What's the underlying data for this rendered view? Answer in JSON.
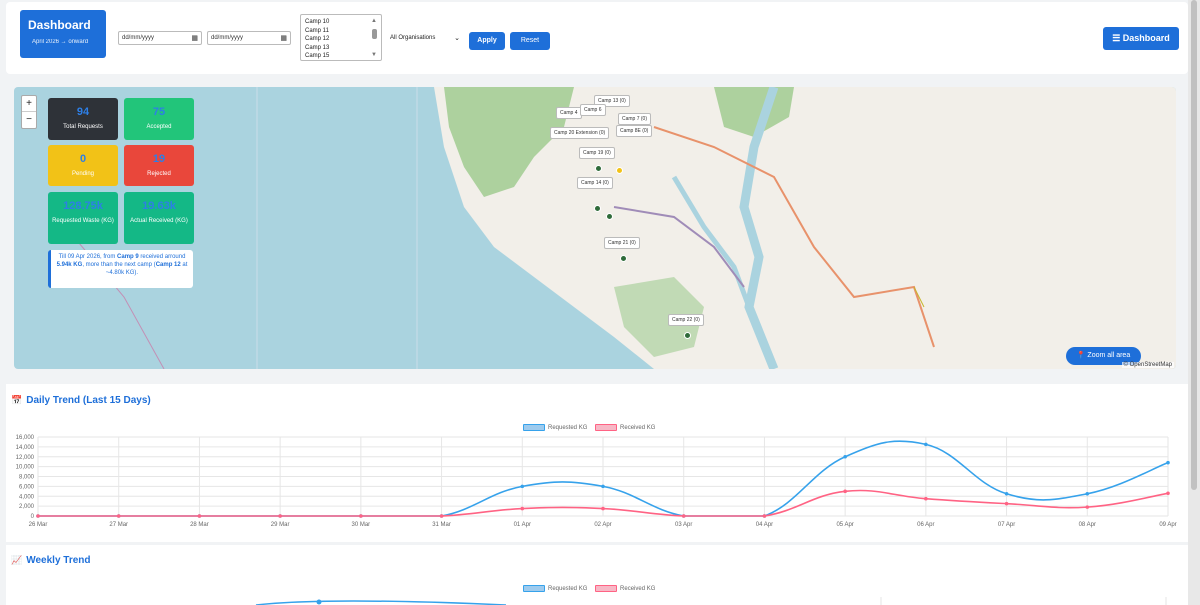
{
  "header": {
    "brand_title": "Dashboard",
    "brand_subtitle": "April 2026 → onward",
    "date_from_placeholder": "dd/mm/yyyy",
    "date_to_placeholder": "dd/mm/yyyy",
    "camp_options": [
      "Camp 10",
      "Camp 11",
      "Camp 12",
      "Camp 13",
      "Camp 15"
    ],
    "org_select": "All Organisations",
    "apply_label": "Apply",
    "reset_label": "Reset",
    "dashboard_label": "☰ Dashboard"
  },
  "map": {
    "stats": [
      {
        "value": "94",
        "label": "Total Requests",
        "color": "#2e3238"
      },
      {
        "value": "75",
        "label": "Accepted",
        "color": "#22c57a"
      },
      {
        "value": "0",
        "label": "Pending",
        "color": "#f2c217"
      },
      {
        "value": "19",
        "label": "Rejected",
        "color": "#e9473b"
      },
      {
        "value": "128.75k",
        "label": "Requested Waste (KG)",
        "color": "#14b886"
      },
      {
        "value": "19.63k",
        "label": "Actual Received (KG)",
        "color": "#14b886"
      }
    ],
    "note": {
      "pre": "Till 09 Apr 2026, from ",
      "camp": "Camp 9",
      "mid": " received arround ",
      "amount": "5.94k KG",
      "mid2": ", more than the next camp (",
      "next_camp": "Camp 12",
      "post": " at ~4.80k KG)."
    },
    "pins": [
      "Camp 13 (0)",
      "Camp 4",
      "Camp 6",
      "Camp 7 (0)",
      "Camp 20 Extension (0)",
      "Camp 8E (0)",
      "Camp 14 (0)",
      "Camp 19 (0)",
      "Camp 21 (0)",
      "Camp 22 (0)"
    ],
    "zoom_in": "+",
    "zoom_out": "−",
    "zoom_all_label": "📍 Zoom all area",
    "attribution": "© OpenStreetMap"
  },
  "daily": {
    "title": "Daily Trend (Last 15 Days)",
    "icon": "calendar-icon"
  },
  "weekly": {
    "title": "Weekly Trend",
    "icon": "chart-icon"
  },
  "legend": {
    "requested": "Requested KG",
    "received": "Received KG"
  },
  "colors": {
    "requested": "#36a2eb",
    "received": "#ff6384",
    "accent": "#1e6fd9"
  },
  "chart_data": [
    {
      "type": "line",
      "title": "Daily Trend (Last 15 Days)",
      "categories": [
        "26 Mar",
        "27 Mar",
        "28 Mar",
        "29 Mar",
        "30 Mar",
        "31 Mar",
        "01 Apr",
        "02 Apr",
        "03 Apr",
        "04 Apr",
        "05 Apr",
        "06 Apr",
        "07 Apr",
        "08 Apr",
        "09 Apr"
      ],
      "series": [
        {
          "name": "Requested KG",
          "values": [
            0,
            0,
            0,
            0,
            0,
            0,
            6000,
            6000,
            0,
            0,
            12000,
            14500,
            4500,
            4500,
            10800
          ]
        },
        {
          "name": "Received KG",
          "values": [
            0,
            0,
            0,
            0,
            0,
            0,
            1500,
            1500,
            0,
            0,
            5000,
            3500,
            2500,
            1800,
            4600
          ]
        }
      ],
      "ylim": [
        0,
        16000
      ],
      "yticks": [
        "0",
        "2,000",
        "4,000",
        "6,000",
        "8,000",
        "10,000",
        "12,000",
        "14,000",
        "16,000"
      ],
      "grid": true,
      "legend": "top-center"
    },
    {
      "type": "line",
      "title": "Weekly Trend",
      "series": [
        {
          "name": "Requested KG"
        },
        {
          "name": "Received KG"
        }
      ],
      "legend": "top-center"
    }
  ]
}
